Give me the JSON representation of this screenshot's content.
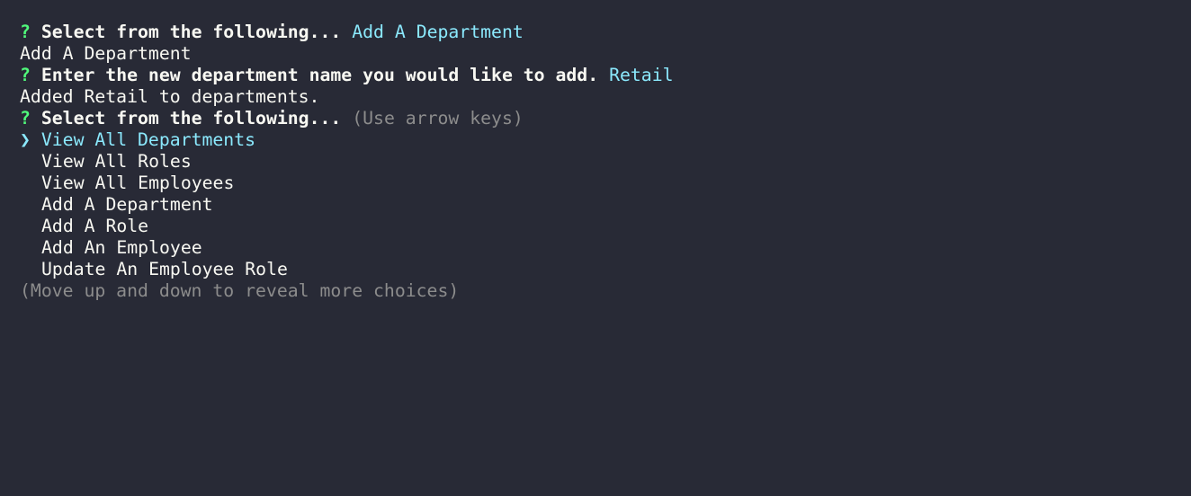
{
  "colors": {
    "background": "#282a36",
    "text": "#f8f8f2",
    "prompt_marker": "#50fa7b",
    "answer": "#8be9fd",
    "hint": "#8c8c8c"
  },
  "history": {
    "prompt1": {
      "marker": "?",
      "question": "Select from the following...",
      "answer": "Add A Department"
    },
    "echo1": "Add A Department",
    "prompt2": {
      "marker": "?",
      "question": "Enter the new department name you would like to add.",
      "answer": "Retail"
    },
    "echo2": "Added Retail to departments."
  },
  "active_prompt": {
    "marker": "?",
    "question": "Select from the following...",
    "hint": "(Use arrow keys)",
    "pointer_icon": "❯",
    "choices": [
      "View All Departments",
      "View All Roles",
      "View All Employees",
      "Add A Department",
      "Add A Role",
      "Add An Employee",
      "Update An Employee Role"
    ],
    "selected_index": 0,
    "footer_hint": "(Move up and down to reveal more choices)"
  }
}
